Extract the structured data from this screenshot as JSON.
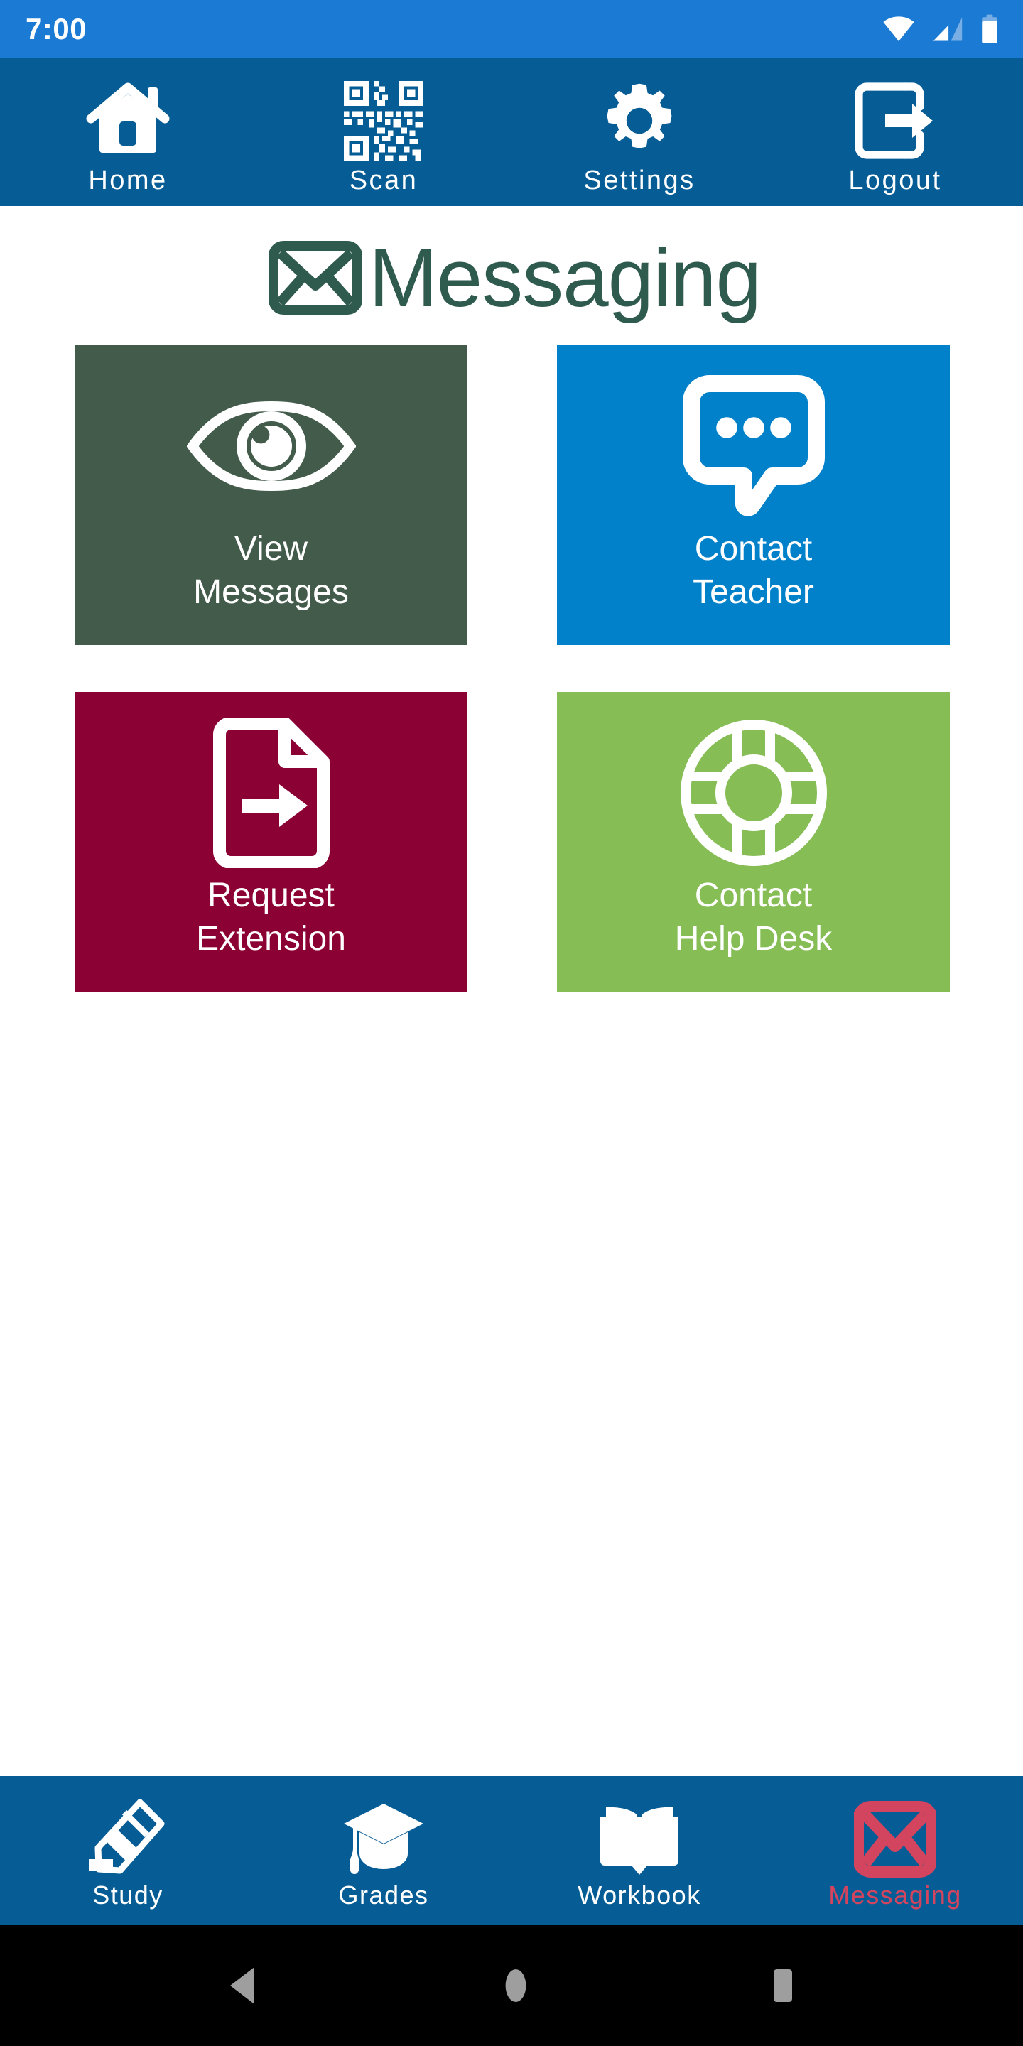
{
  "status_bar": {
    "clock": "7:00",
    "icons": [
      {
        "name": "wifi-icon",
        "label": "wifi"
      },
      {
        "name": "cellular-signal-icon",
        "label": "cellular"
      },
      {
        "name": "battery-icon",
        "label": "battery"
      }
    ],
    "background": "#1b7ad4",
    "foreground": "#ffffff"
  },
  "top_nav": {
    "background": "#065C95",
    "items": [
      {
        "label": "Home",
        "icon": "home-icon"
      },
      {
        "label": "Scan",
        "icon": "qr-code-icon"
      },
      {
        "label": "Settings",
        "icon": "gear-icon"
      },
      {
        "label": "Logout",
        "icon": "logout-icon"
      }
    ]
  },
  "page_header": {
    "title": "Messaging",
    "icon": "envelope-icon",
    "color": "#2F5A4E"
  },
  "tiles": [
    {
      "label": "View\nMessages",
      "icon": "eye-icon",
      "color": "#435B4A"
    },
    {
      "label": "Contact\nTeacher",
      "icon": "speech-bubble-icon",
      "color": "#0081C9"
    },
    {
      "label": "Request\nExtension",
      "icon": "document-arrow-icon",
      "color": "#8C0133"
    },
    {
      "label": "Contact\nHelp Desk",
      "icon": "lifebuoy-icon",
      "color": "#86BD55"
    }
  ],
  "bottom_nav": {
    "background": "#065C95",
    "active_color": "#D3455F",
    "inactive_color": "#ffffff",
    "items": [
      {
        "label": "Study",
        "icon": "pencil-icon",
        "active": false
      },
      {
        "label": "Grades",
        "icon": "graduation-cap-icon",
        "active": false
      },
      {
        "label": "Workbook",
        "icon": "open-book-icon",
        "active": false
      },
      {
        "label": "Messaging",
        "icon": "envelope-icon",
        "active": true
      }
    ]
  },
  "system_nav": {
    "background": "#000000",
    "icon_color": "#9e9e9e",
    "items": [
      {
        "name": "back-button",
        "label": "Back"
      },
      {
        "name": "home-button",
        "label": "Home"
      },
      {
        "name": "recents-button",
        "label": "Recents"
      }
    ]
  }
}
